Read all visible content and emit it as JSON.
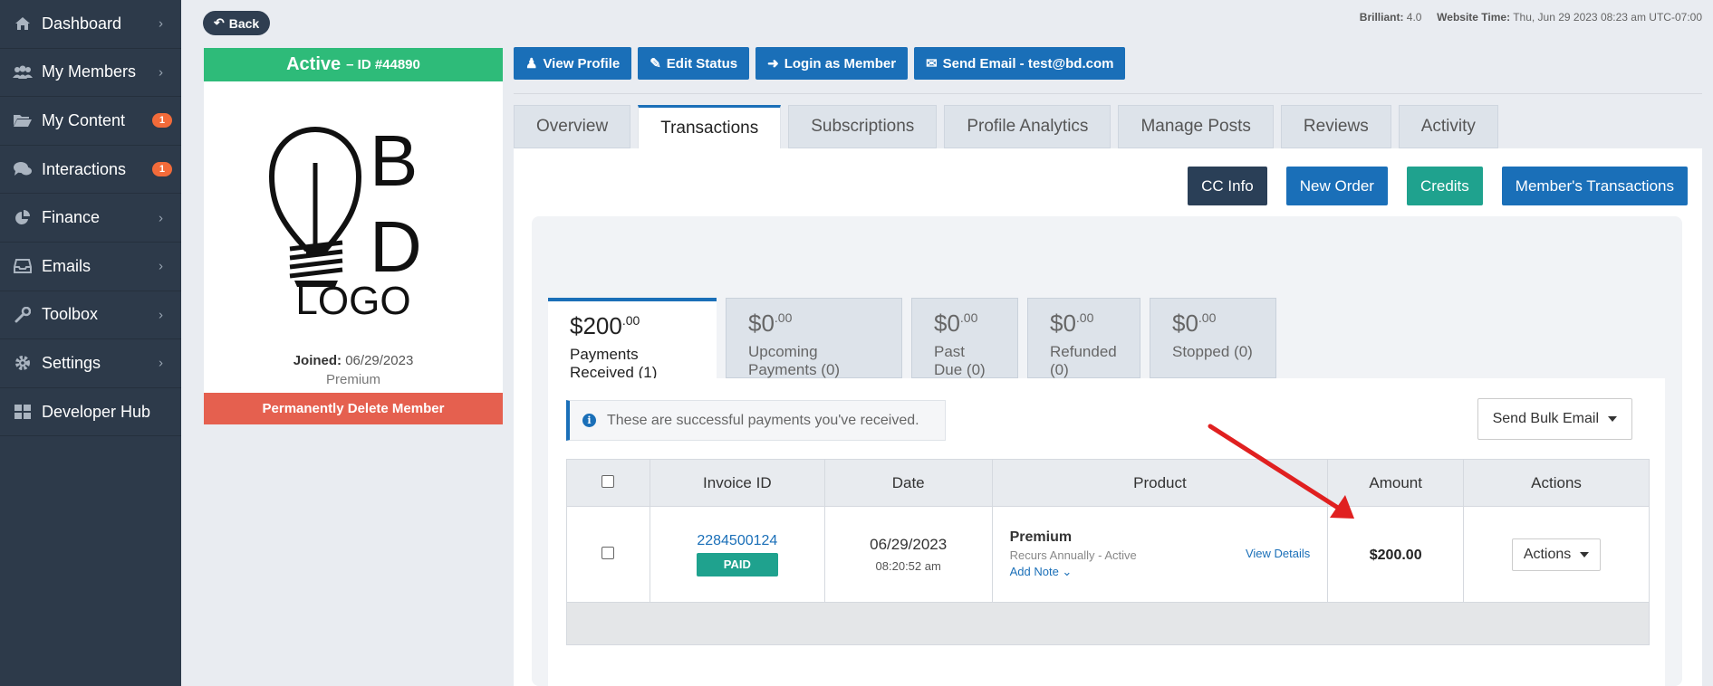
{
  "sidebar": {
    "items": [
      {
        "label": "Dashboard",
        "icon": "home-icon",
        "chevron": true
      },
      {
        "label": "My Members",
        "icon": "users-icon",
        "chevron": true
      },
      {
        "label": "My Content",
        "icon": "folder-icon",
        "badge": "1"
      },
      {
        "label": "Interactions",
        "icon": "comments-icon",
        "badge": "1"
      },
      {
        "label": "Finance",
        "icon": "pie-chart-icon",
        "chevron": true
      },
      {
        "label": "Emails",
        "icon": "inbox-icon",
        "chevron": true
      },
      {
        "label": "Toolbox",
        "icon": "wrench-icon",
        "chevron": true
      },
      {
        "label": "Settings",
        "icon": "gear-icon",
        "chevron": true
      },
      {
        "label": "Developer Hub",
        "icon": "grid-icon",
        "chevron": false
      }
    ]
  },
  "topbar": {
    "back_label": "Back",
    "brilliant_label": "Brilliant:",
    "brilliant_value": "4.0",
    "website_time_label": "Website Time:",
    "website_time_value": "Thu, Jun 29 2023 08:23 am UTC-07:00"
  },
  "member": {
    "status": "Active",
    "id_text": "– ID #44890",
    "logo_text": "LOGO",
    "logo_letters": [
      "B",
      "D"
    ],
    "joined_label": "Joined:",
    "joined_date": "06/29/2023",
    "level": "Premium",
    "delete_label": "Permanently Delete Member"
  },
  "actions": {
    "view_profile": "View Profile",
    "edit_status": "Edit Status",
    "login_as_member": "Login as Member",
    "send_email": "Send Email - test@bd.com"
  },
  "tabs": [
    "Overview",
    "Transactions",
    "Subscriptions",
    "Profile Analytics",
    "Manage Posts",
    "Reviews",
    "Activity"
  ],
  "active_tab": "Transactions",
  "panel_buttons": [
    {
      "label": "CC Info",
      "color": "#2a3f57"
    },
    {
      "label": "New Order",
      "color": "#1a6fb8"
    },
    {
      "label": "Credits",
      "color": "#1fa28e"
    },
    {
      "label": "Member's Transactions",
      "color": "#1a6fb8"
    }
  ],
  "summary": [
    {
      "amount": "$200",
      "cents": ".00",
      "label": "Payments Received (1)"
    },
    {
      "amount": "$0",
      "cents": ".00",
      "label": "Upcoming Payments (0)"
    },
    {
      "amount": "$0",
      "cents": ".00",
      "label": "Past Due (0)"
    },
    {
      "amount": "$0",
      "cents": ".00",
      "label": "Refunded (0)"
    },
    {
      "amount": "$0",
      "cents": ".00",
      "label": "Stopped (0)"
    }
  ],
  "info_message": "These are successful payments you've received.",
  "bulk_email_label": "Send Bulk Email",
  "table": {
    "headers": [
      "",
      "Invoice ID",
      "Date",
      "Product",
      "Amount",
      "Actions"
    ],
    "rows": [
      {
        "invoice_id": "2284500124",
        "status": "PAID",
        "date": "06/29/2023",
        "time": "08:20:52 am",
        "product": "Premium",
        "product_sub": "Recurs Annually - Active",
        "add_note": "Add Note ⌄",
        "view_details": "View Details",
        "amount": "$200.00",
        "actions_label": "Actions"
      }
    ]
  },
  "colors": {
    "sidebar_bg": "#2d3a4a",
    "status_green": "#2ebb79",
    "delete_red": "#e5604f",
    "primary_blue": "#1a6fb8",
    "teal": "#1fa28e",
    "badge_orange": "#f26b3a",
    "arrow_red": "#e02020"
  }
}
